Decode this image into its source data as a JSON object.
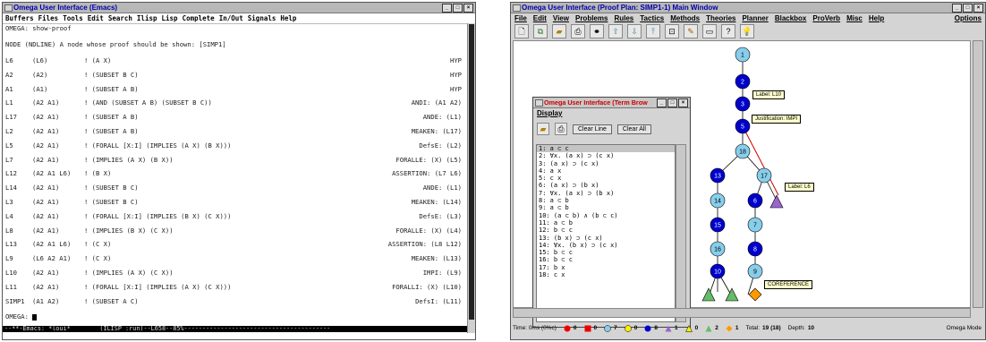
{
  "emacs": {
    "title": "Omega User Interface (Emacs)",
    "menu": [
      "Buffers",
      "Files",
      "Tools",
      "Edit",
      "Search",
      "Ilisp",
      "Lisp",
      "Complete",
      "In/Out",
      "Signals",
      "Help"
    ],
    "prompt1": "OMEGA: show-proof",
    "prompt2": "NODE (NDLINE) A node whose proof should be shown: [SIMP1]",
    "lines": [
      {
        "label": "L6",
        "hyps": "(L6)",
        "formula": "! (A X)",
        "just": "HYP"
      },
      {
        "label": "A2",
        "hyps": "(A2)",
        "formula": "! (SUBSET B C)",
        "just": "HYP"
      },
      {
        "label": "A1",
        "hyps": "(A1)",
        "formula": "! (SUBSET A B)",
        "just": "HYP"
      },
      {
        "label": "L1",
        "hyps": "(A2 A1)",
        "formula": "! (AND (SUBSET A B) (SUBSET B C))",
        "just": "ANDI: (A1 A2)"
      },
      {
        "label": "L17",
        "hyps": "(A2 A1)",
        "formula": "! (SUBSET A B)",
        "just": "ANDE: (L1)"
      },
      {
        "label": "L2",
        "hyps": "(A2 A1)",
        "formula": "! (SUBSET A B)",
        "just": "MEAKEN: (L17)"
      },
      {
        "label": "L5",
        "hyps": "(A2 A1)",
        "formula": "! (FORALL [X:I] (IMPLIES (A X) (B X)))",
        "just": "DefsE: (L2)"
      },
      {
        "label": "L7",
        "hyps": "(A2 A1)",
        "formula": "! (IMPLIES (A X) (B X))",
        "just": "FORALLE: (X) (L5)"
      },
      {
        "label": "L12",
        "hyps": "(A2 A1 L6)",
        "formula": "! (B X)",
        "just": "ASSERTION: (L7 L6)"
      },
      {
        "label": "L14",
        "hyps": "(A2 A1)",
        "formula": "! (SUBSET B C)",
        "just": "ANDE: (L1)"
      },
      {
        "label": "L3",
        "hyps": "(A2 A1)",
        "formula": "! (SUBSET B C)",
        "just": "MEAKEN: (L14)"
      },
      {
        "label": "L4",
        "hyps": "(A2 A1)",
        "formula": "! (FORALL [X:I] (IMPLIES (B X) (C X)))",
        "just": "DefsE: (L3)"
      },
      {
        "label": "L8",
        "hyps": "(A2 A1)",
        "formula": "! (IMPLIES (B X) (C X))",
        "just": "FORALLE: (X) (L4)"
      },
      {
        "label": "L13",
        "hyps": "(A2 A1 L6)",
        "formula": "! (C X)",
        "just": "ASSERTION: (L8 L12)"
      },
      {
        "label": "L9",
        "hyps": "(L6 A2 A1)",
        "formula": "! (C X)",
        "just": "MEAKEN: (L13)"
      },
      {
        "label": "L10",
        "hyps": "(A2 A1)",
        "formula": "! (IMPLIES (A X) (C X))",
        "just": "IMPI: (L9)"
      },
      {
        "label": "L11",
        "hyps": "(A2 A1)",
        "formula": "! (FORALL [X:I] (IMPLIES (A X) (C X)))",
        "just": "FORALLI: (X) (L10)"
      },
      {
        "label": "SIMP1",
        "hyps": "(A1 A2)",
        "formula": "! (SUBSET A C)",
        "just": "DefsI: (L11)"
      }
    ],
    "final_prompt": "OMEGA:",
    "modeline": "--**-Emacs: *loui*        (ILISP :run)--L658--85%----------------------------------------"
  },
  "omega": {
    "title": "Omega User Interface (Proof Plan: SIMP1-1) Main Window",
    "menu": [
      "File",
      "Edit",
      "View",
      "Problems",
      "Rules",
      "Tactics",
      "Methods",
      "Theories",
      "Planner",
      "Blackbox",
      "ProVerb",
      "Misc",
      "Help"
    ],
    "options_label": "Options",
    "toolbar_icons": [
      "new-icon",
      "copy-icon",
      "open-icon",
      "print-icon",
      "binoculars-icon",
      "arrow-up-icon",
      "arrow-down-icon",
      "arrow-top-icon",
      "zoom-fit-icon",
      "brush-icon",
      "window-icon",
      "help-icon",
      "bulb-icon"
    ],
    "term_browser": {
      "title": "Omega User Interface (Term Brow",
      "menu": "Display",
      "btn_clear_line": "Clear Line",
      "btn_clear_all": "Clear All",
      "rows": [
        "1: a ⊂ c",
        "2: ∀x. (a x) ⊃ (c x)",
        "3: (a x) ⊃ (c x)",
        "4: a x",
        "5: c x",
        "6: (a x) ⊃ (b x)",
        "7: ∀x. (a x) ⊃ (b x)",
        "8: a ⊂ b",
        "9: a ⊂ b",
        "10: (a ⊂ b) ∧ (b ⊂ c)",
        "11: a ⊂ b",
        "12: b ⊂ c",
        "13: (b x) ⊃ (c x)",
        "14: ∀x. (b x) ⊃ (c x)",
        "15: b ⊂ c",
        "16: b ⊂ c",
        "17: b x",
        "18: c x"
      ]
    },
    "nodes": [
      {
        "id": "n1",
        "label": "1",
        "fill": "#87ceeb"
      },
      {
        "id": "n2",
        "label": "2",
        "fill": "#0000cc"
      },
      {
        "id": "n3",
        "label": "3",
        "fill": "#0000cc"
      },
      {
        "id": "n5",
        "label": "5",
        "fill": "#0000cc"
      },
      {
        "id": "n18",
        "label": "18",
        "fill": "#87ceeb"
      },
      {
        "id": "n13",
        "label": "13",
        "fill": "#0000cc"
      },
      {
        "id": "n17",
        "label": "17",
        "fill": "#87ceeb"
      },
      {
        "id": "n14",
        "label": "14",
        "fill": "#87ceeb"
      },
      {
        "id": "n6",
        "label": "6",
        "fill": "#0000cc"
      },
      {
        "id": "n15",
        "label": "15",
        "fill": "#0000cc"
      },
      {
        "id": "n7",
        "label": "7",
        "fill": "#87ceeb"
      },
      {
        "id": "n16",
        "label": "16",
        "fill": "#87ceeb"
      },
      {
        "id": "n8",
        "label": "8",
        "fill": "#0000cc"
      },
      {
        "id": "n10",
        "label": "10",
        "fill": "#0000cc"
      },
      {
        "id": "n9",
        "label": "9",
        "fill": "#87ceeb"
      }
    ],
    "labels": {
      "l10": "Label: L10",
      "impi": "Justification: IMPI",
      "l6": "Label: L6",
      "coref": "COREFERENCE"
    },
    "status": {
      "time": "Time: 0ms (0%c)",
      "red_circle": "0",
      "red_square": "0",
      "light_circle": "7",
      "yellow_circle": "0",
      "blue_circle": "8",
      "purple_tri": "1",
      "yellow_tri": "0",
      "green_tri": "2",
      "orange_diamond": "1",
      "total": "19 (18)",
      "total_label": "Total:",
      "depth": "10",
      "depth_label": "Depth:",
      "mode": "Omega Mode"
    }
  }
}
